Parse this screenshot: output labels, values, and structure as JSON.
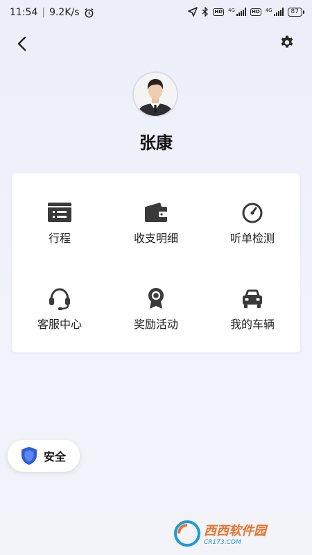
{
  "status_bar": {
    "time": "11:54",
    "speed": "9.2K/s",
    "battery": "87",
    "net_label": "4G",
    "hd_label": "HD"
  },
  "header": {
    "back_icon": "chevron-left-icon",
    "settings_icon": "gear-icon"
  },
  "profile": {
    "name": "张康"
  },
  "grid": {
    "items": [
      {
        "label": "行程",
        "icon": "itinerary-icon"
      },
      {
        "label": "收支明细",
        "icon": "wallet-icon"
      },
      {
        "label": "听单检测",
        "icon": "gauge-icon"
      },
      {
        "label": "客服中心",
        "icon": "headset-icon"
      },
      {
        "label": "奖励活动",
        "icon": "award-icon"
      },
      {
        "label": "我的车辆",
        "icon": "car-icon"
      }
    ]
  },
  "safety": {
    "label": "安全",
    "icon": "shield-icon"
  },
  "watermark": {
    "brand": "西西软件园",
    "site": "CR173.COM"
  },
  "colors": {
    "shield": "#2f5fd8",
    "icon": "#3a3a3a",
    "watermark_orange": "#e9742c",
    "watermark_blue": "#1b9bd8"
  }
}
